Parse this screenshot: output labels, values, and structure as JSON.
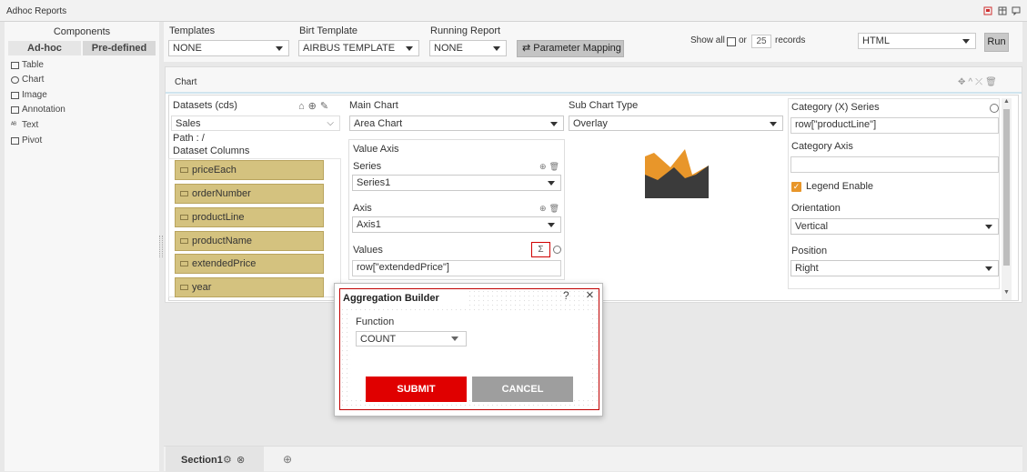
{
  "app": {
    "title": "Adhoc Reports"
  },
  "sidebar": {
    "heading": "Components",
    "tabs": [
      "Ad-hoc",
      "Pre-defined"
    ],
    "items": [
      "Table",
      "Chart",
      "Image",
      "Annotation",
      "Text",
      "Pivot"
    ]
  },
  "topbar": {
    "templates": {
      "label": "Templates",
      "value": "NONE"
    },
    "birt": {
      "label": "Birt Template",
      "value": "AIRBUS TEMPLATE"
    },
    "running": {
      "label": "Running Report",
      "value": "NONE"
    },
    "param_mapping": "Parameter Mapping",
    "show_all": "Show all",
    "or": "or",
    "records_count": "25",
    "records": "records",
    "format": "HTML",
    "run": "Run"
  },
  "chart_panel": {
    "title": "Chart",
    "datasets": {
      "label": "Datasets (cds)",
      "value": "Sales",
      "path": "Path : /",
      "columns_label": "Dataset Columns",
      "columns": [
        "priceEach",
        "orderNumber",
        "productLine",
        "productName",
        "extendedPrice",
        "year"
      ]
    },
    "main_chart": {
      "label": "Main Chart",
      "value": "Area Chart"
    },
    "value_axis": {
      "label": "Value Axis",
      "series_label": "Series",
      "series_value": "Series1",
      "axis_label": "Axis",
      "axis_value": "Axis1",
      "values_label": "Values",
      "values_value": "row[\"extendedPrice\"]",
      "sigma": "Σ"
    },
    "sub_chart": {
      "label": "Sub Chart Type",
      "value": "Overlay"
    },
    "category": {
      "series_label": "Category (X) Series",
      "series_value": "row[\"productLine\"]",
      "axis_label": "Category Axis",
      "axis_value": "",
      "legend_label": "Legend Enable",
      "legend_checked": true,
      "orientation_label": "Orientation",
      "orientation_value": "Vertical",
      "position_label": "Position",
      "position_value": "Right"
    }
  },
  "dialog": {
    "title": "Aggregation Builder",
    "help": "?",
    "close": "×",
    "function_label": "Function",
    "function_value": "COUNT",
    "submit": "SUBMIT",
    "cancel": "CANCEL"
  },
  "bottom": {
    "section": "Section1"
  },
  "colors": {
    "accent_red": "#e00000",
    "column_chip": "#d4c27f",
    "chart_orange": "#e8962a",
    "chart_dark": "#3b3b3b"
  }
}
